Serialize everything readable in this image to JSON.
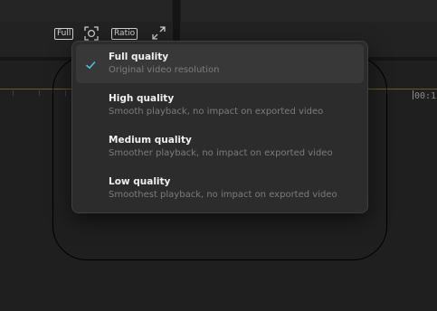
{
  "toolbar": {
    "full_label": "Full",
    "ratio_label": "Ratio",
    "focus_icon": "focus-frame-icon",
    "expand_icon": "expand-icon"
  },
  "ruler": {
    "time_label": "00:1"
  },
  "quality_menu": {
    "selected_index": 0,
    "accent_color": "#3ec6e0",
    "items": [
      {
        "label": "Full quality",
        "description": "Original video resolution"
      },
      {
        "label": "High quality",
        "description": "Smooth playback, no impact on exported video"
      },
      {
        "label": "Medium quality",
        "description": "Smoother playback, no impact on exported video"
      },
      {
        "label": "Low quality",
        "description": "Smoothest playback, no impact on exported video"
      }
    ]
  }
}
